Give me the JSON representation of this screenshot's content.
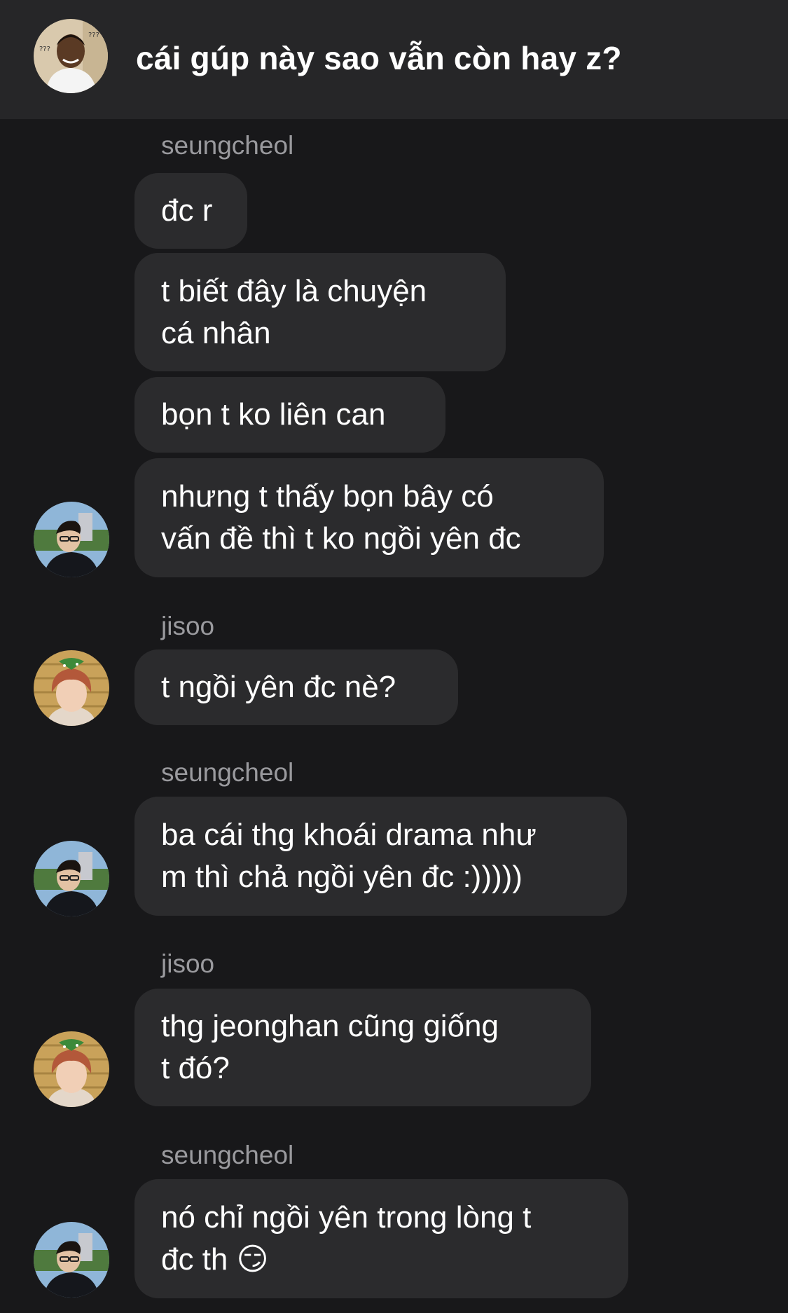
{
  "header": {
    "title": "cái gúp này sao vẫn còn hay z?",
    "avatar_icon": "group-avatar-icon"
  },
  "messages": [
    {
      "sender": "seungcheol",
      "text": "đc r"
    },
    {
      "sender": "seungcheol",
      "text": "t biết đây là chuyện\ncá nhân"
    },
    {
      "sender": "seungcheol",
      "text": "bọn t ko liên can"
    },
    {
      "sender": "seungcheol",
      "text": "nhưng t thấy bọn bây có\nvấn đề thì t ko ngồi yên đc"
    },
    {
      "sender": "jisoo",
      "text": "t ngồi yên đc nè?"
    },
    {
      "sender": "seungcheol",
      "text": "ba cái thg khoái drama như\nm thì chả ngồi yên đc :)))))"
    },
    {
      "sender": "jisoo",
      "text": "thg jeonghan cũng giống\nt đó?"
    },
    {
      "sender": "seungcheol",
      "text": "nó chỉ ngồi yên trong lòng t\nđc th 😏"
    }
  ],
  "colors": {
    "background": "#18181a",
    "header": "#262628",
    "bubble": "#2b2b2d",
    "sender_label": "#9a9a9e"
  }
}
